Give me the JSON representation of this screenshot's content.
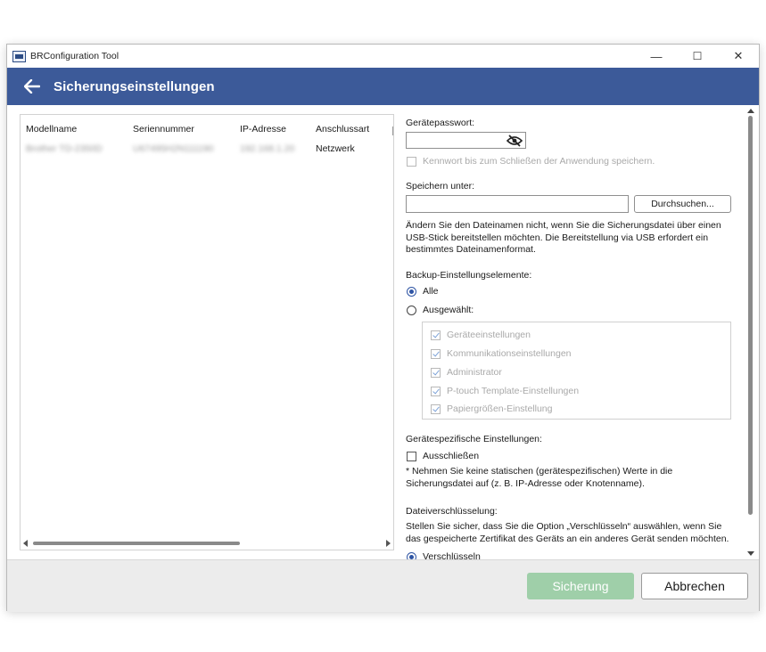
{
  "window": {
    "title": "BRConfiguration Tool",
    "controls": {
      "minimize": "—",
      "maximize": "☐",
      "close": "✕"
    }
  },
  "header": {
    "title": "Sicherungseinstellungen",
    "back_icon": "back-arrow-icon"
  },
  "device_list": {
    "columns": [
      "Modellname",
      "Seriennummer",
      "IP-Adresse",
      "Anschlussart"
    ],
    "rows": [
      {
        "model": "Brother TD-2350D",
        "serial": "U67495H2N111190",
        "ip": "192.168.1.20",
        "connection": "Netzwerk"
      }
    ]
  },
  "form": {
    "password_label": "Gerätepasswort:",
    "password_value": "",
    "remember_label": "Kennwort bis zum Schließen der Anwendung speichern.",
    "save_as_label": "Speichern unter:",
    "save_as_value": "",
    "browse_label": "Durchsuchen...",
    "filename_note": "Ändern Sie den Dateinamen nicht, wenn Sie die Sicherungsdatei über einen USB-Stick bereitstellen möchten. Die Bereitstellung via USB erfordert ein bestimmtes Dateinamenformat.",
    "backup_items_label": "Backup-Einstellungselemente:",
    "radio_all": "Alle",
    "radio_selected": "Ausgewählt:",
    "items": [
      "Geräteeinstellungen",
      "Kommunikationseinstellungen",
      "Administrator",
      "P-touch Template-Einstellungen",
      "Papiergrößen-Einstellung"
    ],
    "device_specific_label": "Gerätespezifische Einstellungen:",
    "exclude_label": "Ausschließen",
    "exclude_note": "* Nehmen Sie keine statischen (gerätespezifischen) Werte in die Sicherungsdatei auf (z. B. IP-Adresse oder Knotenname).",
    "encryption_label": "Dateiverschlüsselung:",
    "encryption_note": "Stellen Sie sicher, dass Sie die Option „Verschlüsseln“ auswählen, wenn Sie das gespeicherte Zertifikat des Geräts an ein anderes Gerät senden möchten.",
    "encrypt_option": "Verschlüsseln"
  },
  "footer": {
    "backup_button": "Sicherung",
    "cancel_button": "Abbrechen"
  },
  "colors": {
    "header_bg": "#3c5a99",
    "primary_disabled": "#9fcfa9",
    "radio_accent": "#2f55a4"
  }
}
